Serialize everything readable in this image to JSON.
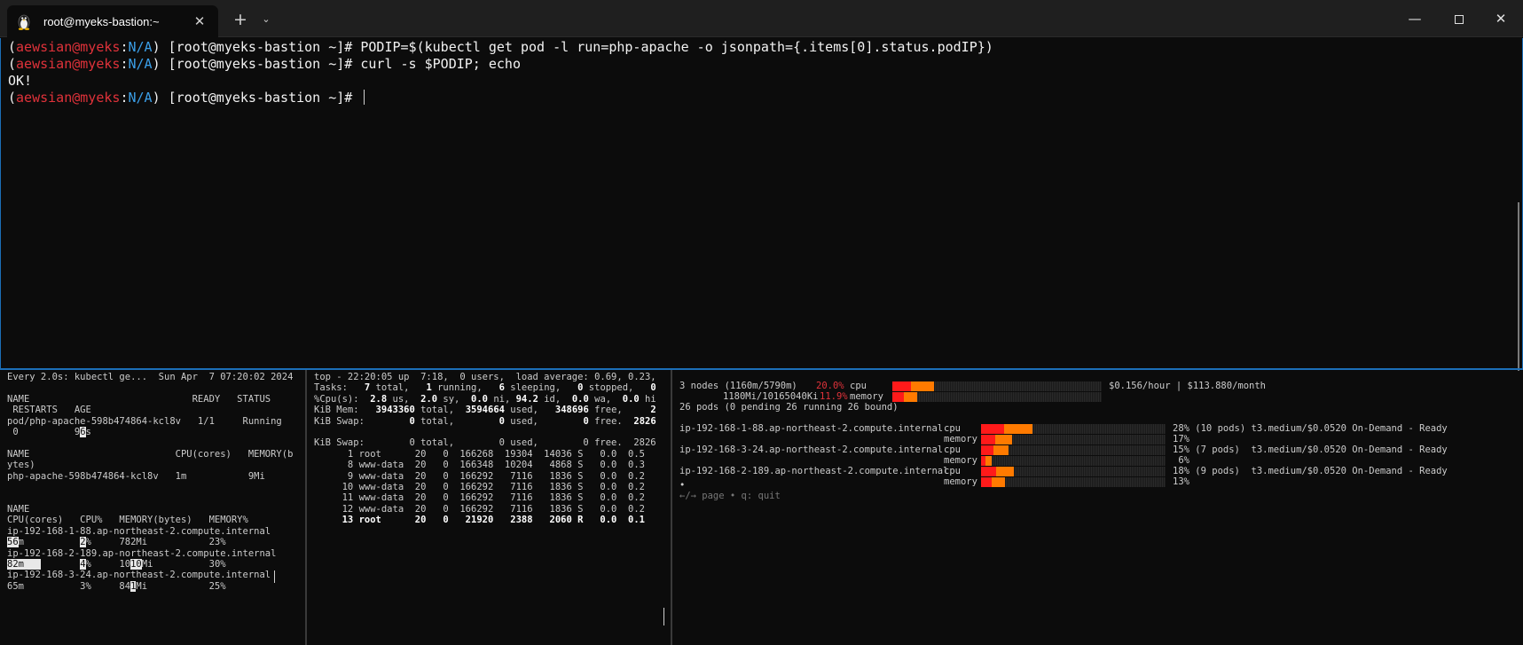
{
  "window": {
    "tab_title": "root@myeks-bastion:~",
    "new_tab_glyph": "+",
    "dropdown_glyph": "⌄",
    "tab_close_glyph": "✕",
    "minimize_glyph": "—",
    "close_glyph": "✕",
    "tab_icon": "linux-penguin-icon"
  },
  "top_pane": {
    "lines": [
      {
        "user": "aewsian@myeks",
        "ctx": "N/A",
        "host": " [root@myeks-bastion ~]# ",
        "cmd": "PODIP=$(kubectl get pod -l run=php-apache -o jsonpath={.items[0].status.podIP})"
      },
      {
        "user": "aewsian@myeks",
        "ctx": "N/A",
        "host": " [root@myeks-bastion ~]# ",
        "cmd": "curl -s $PODIP; echo"
      },
      {
        "output": "OK!"
      },
      {
        "user": "aewsian@myeks",
        "ctx": "N/A",
        "host": " [root@myeks-bastion ~]# ",
        "cmd": ""
      }
    ]
  },
  "watch_pane": {
    "lines": [
      "Every 2.0s: kubectl ge...  Sun Apr  7 07:20:02 2024",
      "",
      "NAME                             READY   STATUS",
      " RESTARTS   AGE",
      "pod/php-apache-598b474864-kcl8v   1/1     Running",
      " 0          9[6]s",
      "",
      "NAME                          CPU(cores)   MEMORY(b",
      "ytes)",
      "php-apache-598b474864-kcl8v   1m           9Mi",
      "",
      "",
      "NAME",
      "CPU(cores)   CPU%   MEMORY(bytes)   MEMORY%",
      "ip-192-168-1-88.ap-northeast-2.compute.internal",
      "[56]m          [2]%     782Mi           23%",
      "ip-192-168-2-189.ap-northeast-2.compute.internal",
      "[82m   ]       [4]%     10[10]Mi          30%",
      "ip-192-168-3-24.ap-northeast-2.compute.internal",
      "65m          3%     84[1]Mi           25%"
    ]
  },
  "top2_pane": {
    "lines": [
      "top - 22:20:05 up  7:18,  0 users,  load average: 0.69, 0.23,",
      "Tasks:   **7** total,   **1** running,   **6** sleeping,   **0** stopped,   **0**",
      "%Cpu(s):  **2.8** us,  **2.0** sy,  **0.0** ni, **94.2** id,  **0.0** wa,  **0.0** hi",
      "KiB Mem:   **3943360** total,  **3594664** used,   **348696** free,     **2**",
      "KiB Swap:        **0** total,        **0** used,        **0** free.  **2826**",
      "",
      "KiB Swap:        0 total,        0 used,        0 free.  2826",
      "      1 root      20   0  166268  19304  14036 S   0.0  0.5",
      "      8 www-data  20   0  166348  10204   4868 S   0.0  0.3",
      "      9 www-data  20   0  166292   7116   1836 S   0.0  0.2",
      "     10 www-data  20   0  166292   7116   1836 S   0.0  0.2",
      "     11 www-data  20   0  166292   7116   1836 S   0.0  0.2",
      "     12 www-data  20   0  166292   7116   1836 S   0.0  0.2",
      "     **13 root      20   0   21920   2388   2060 R   0.0  0.1**"
    ]
  },
  "capacity_pane": {
    "summary": {
      "nodes_text": "3 nodes (1160m/5790m)",
      "cpu_pct": "20.0%",
      "cpu_label": "cpu",
      "mem_text": "1180Mi/10165040Ki",
      "mem_pct": "11.9%",
      "mem_label": "memory",
      "cost": "$0.156/hour | $113.880/month",
      "pods_text": "26 pods (0 pending 26 running 26 bound)",
      "cpu_fill": 0.2,
      "mem_fill": 0.119
    },
    "nodes": [
      {
        "name": "ip-192-168-1-88.ap-northeast-2.compute.internal",
        "cpu_label": "cpu",
        "mem_label": "memory",
        "cpu_text": "28% (10 pods) t3.medium/$0.0520 On-Demand - Ready",
        "mem_text": "17%",
        "cpu_fill": 0.28,
        "mem_fill": 0.17
      },
      {
        "name": "ip-192-168-3-24.ap-northeast-2.compute.internal",
        "cpu_label": "cpu",
        "mem_label": "memory",
        "cpu_text": "15% (7 pods)  t3.medium/$0.0520 On-Demand - Ready",
        "mem_text": " 6%",
        "cpu_fill": 0.15,
        "mem_fill": 0.06
      },
      {
        "name": "ip-192-168-2-189.ap-northeast-2.compute.internal",
        "cpu_label": "cpu",
        "mem_label": "memory",
        "cpu_text": "18% (9 pods)  t3.medium/$0.0520 On-Demand - Ready",
        "mem_text": "13%",
        "cpu_fill": 0.18,
        "mem_fill": 0.13
      }
    ],
    "dot": "•",
    "help": "←/→ page • q: quit"
  }
}
